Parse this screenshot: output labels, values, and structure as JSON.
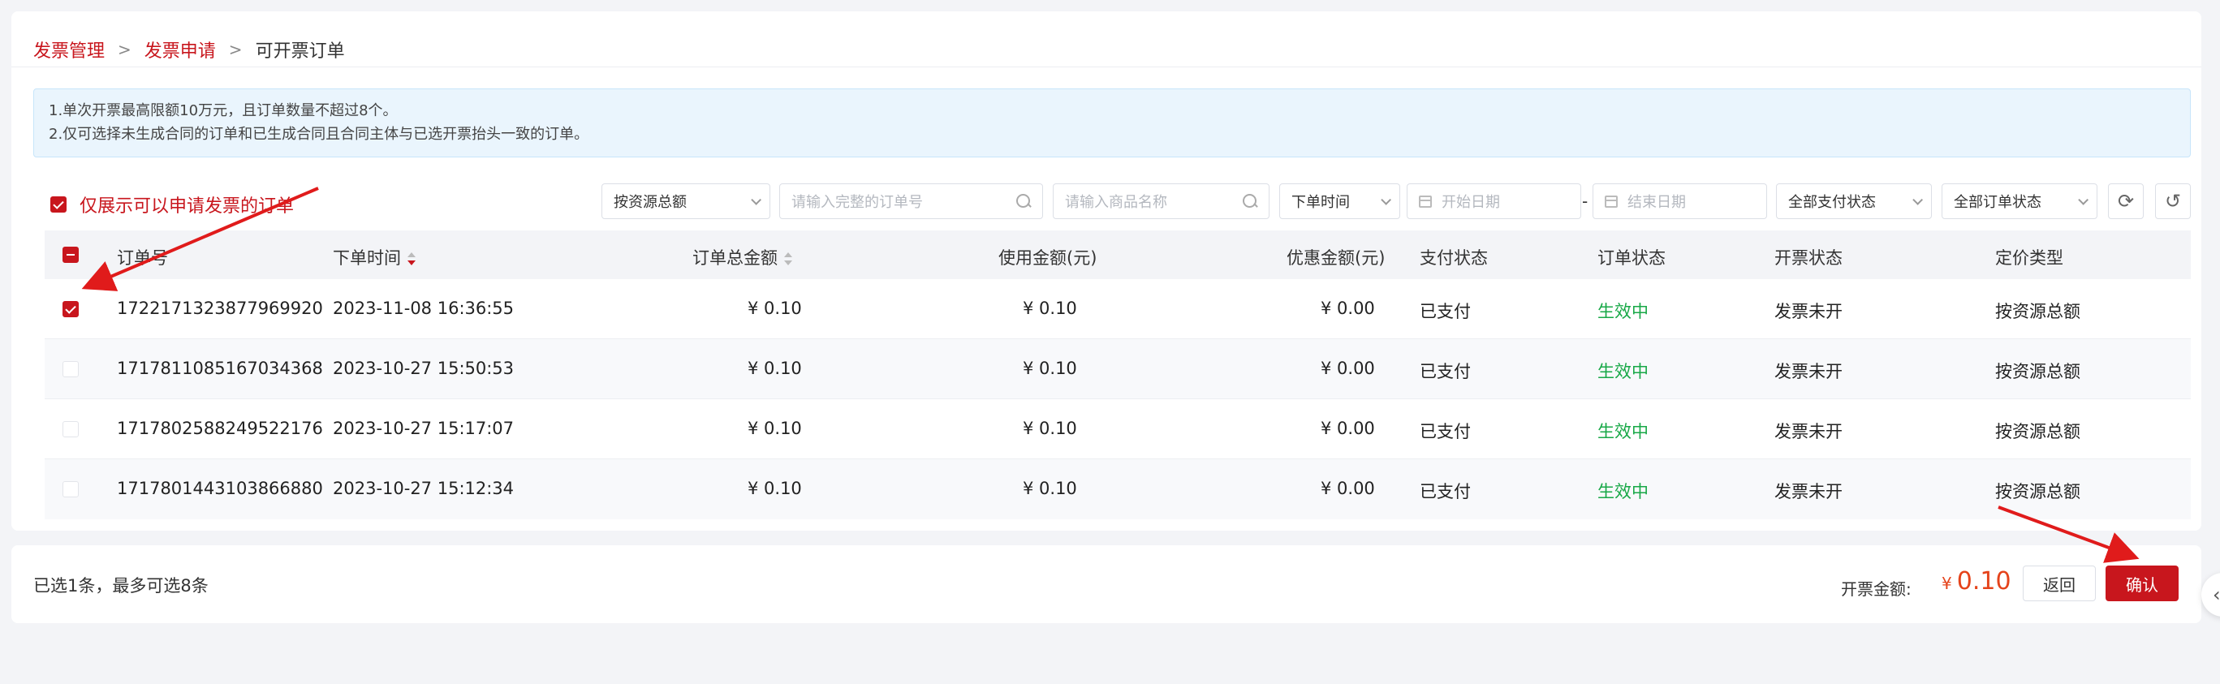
{
  "breadcrumb": {
    "items": [
      "发票管理",
      "发票申请",
      "可开票订单"
    ],
    "separator": ">"
  },
  "notice": {
    "lines": [
      "1.单次开票最高限额10万元，且订单数量不超过8个。",
      "2.仅可选择未生成合同的订单和已生成合同且合同主体与已选开票抬头一致的订单。"
    ]
  },
  "filters": {
    "only_show_label": "仅展示可以申请发票的订单",
    "only_show_checked": true,
    "pricing_select": "按资源总额",
    "order_no_placeholder": "请输入完整的订单号",
    "product_placeholder": "请输入商品名称",
    "time_select": "下单时间",
    "start_date_placeholder": "开始日期",
    "date_separator": "-",
    "end_date_placeholder": "结束日期",
    "pay_status_select": "全部支付状态",
    "order_status_select": "全部订单状态"
  },
  "table": {
    "columns": [
      "订单号",
      "下单时间",
      "订单总金额",
      "使用金额(元)",
      "优惠金额(元)",
      "支付状态",
      "订单状态",
      "开票状态",
      "定价类型"
    ],
    "rows": [
      {
        "checked": true,
        "order_no": "1722171323877969920",
        "time": "2023-11-08 16:36:55",
        "total": "¥ 0.10",
        "used": "¥ 0.10",
        "discount": "¥ 0.00",
        "pay_status": "已支付",
        "order_status": "生效中",
        "invoice_status": "发票未开",
        "pricing": "按资源总额"
      },
      {
        "checked": false,
        "order_no": "1717811085167034368",
        "time": "2023-10-27 15:50:53",
        "total": "¥ 0.10",
        "used": "¥ 0.10",
        "discount": "¥ 0.00",
        "pay_status": "已支付",
        "order_status": "生效中",
        "invoice_status": "发票未开",
        "pricing": "按资源总额"
      },
      {
        "checked": false,
        "order_no": "1717802588249522176",
        "time": "2023-10-27 15:17:07",
        "total": "¥ 0.10",
        "used": "¥ 0.10",
        "discount": "¥ 0.00",
        "pay_status": "已支付",
        "order_status": "生效中",
        "invoice_status": "发票未开",
        "pricing": "按资源总额"
      },
      {
        "checked": false,
        "order_no": "1717801443103866880",
        "time": "2023-10-27 15:12:34",
        "total": "¥ 0.10",
        "used": "¥ 0.10",
        "discount": "¥ 0.00",
        "pay_status": "已支付",
        "order_status": "生效中",
        "invoice_status": "发票未开",
        "pricing": "按资源总额"
      }
    ]
  },
  "footer": {
    "selection_info": "已选1条，最多可选8条",
    "amount_label": "开票金额:",
    "amount_currency": "¥",
    "amount_value": "0.10",
    "back_label": "返回",
    "confirm_label": "确认"
  },
  "colors": {
    "brand": "#c8161d",
    "success": "#18a847",
    "amount": "#e5431b",
    "notice_bg": "#eaf5fd"
  },
  "icons": [
    "search-icon",
    "calendar-icon",
    "chevron-down-icon",
    "refresh-icon",
    "reset-icon",
    "sort-icon",
    "collapse-left-icon"
  ]
}
